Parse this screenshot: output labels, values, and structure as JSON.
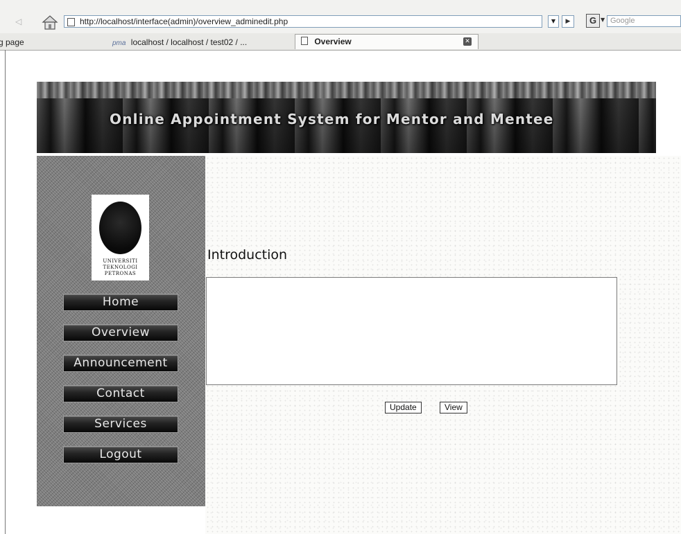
{
  "browser": {
    "url": "http://localhost/interface(admin)/overview_adminedit.php",
    "search_placeholder": "Google",
    "search_engine_letter": "G",
    "tabs": [
      {
        "label": "g page",
        "active": false
      },
      {
        "label": "localhost / localhost / test02 / ...",
        "active": false
      },
      {
        "label": "Overview",
        "active": true
      }
    ]
  },
  "banner": {
    "title": "Online Appointment System for Mentor and Mentee"
  },
  "sidebar": {
    "logo_lines": [
      "UNIVERSITI",
      "TEKNOLOGI",
      "PETRONAS"
    ],
    "items": [
      {
        "label": "Home"
      },
      {
        "label": "Overview"
      },
      {
        "label": "Announcement"
      },
      {
        "label": "Contact"
      },
      {
        "label": "Services"
      },
      {
        "label": "Logout"
      }
    ]
  },
  "main": {
    "section_title": "Introduction",
    "intro_text": "",
    "update_label": "Update",
    "view_label": "View"
  }
}
